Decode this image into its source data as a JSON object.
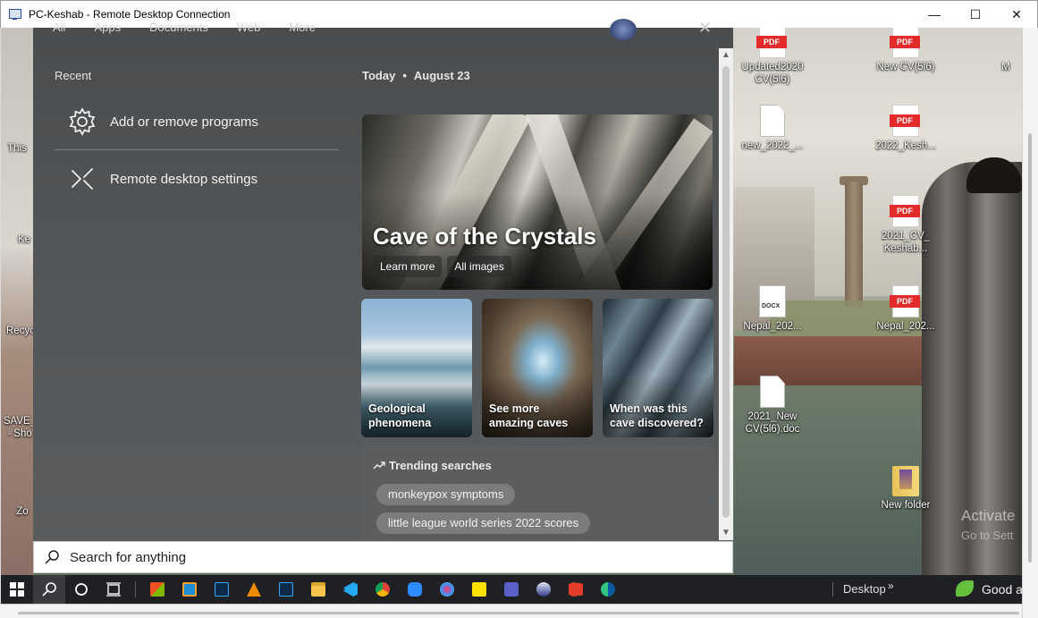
{
  "window": {
    "title": "PC-Keshab - Remote Desktop Connection",
    "minimize": "—",
    "maximize": "☐",
    "close": "✕"
  },
  "panel": {
    "top_tabs": [
      "All",
      "Apps",
      "Documents",
      "Web",
      "More"
    ],
    "recent": {
      "label": "Recent",
      "items": [
        {
          "label": "Add or remove programs",
          "icon": "gear-icon"
        },
        {
          "label": "Remote desktop settings",
          "icon": "remote-desktop-icon"
        }
      ]
    },
    "today": {
      "label": "Today",
      "separator": "•",
      "date": "August 23"
    },
    "hero": {
      "title": "Cave of the Crystals",
      "buttons": [
        "Learn more",
        "All images"
      ]
    },
    "tiles": [
      {
        "label": "Geological phenomena"
      },
      {
        "label": "See more amazing caves"
      },
      {
        "label": "When was this cave discovered?"
      }
    ],
    "trending": {
      "label": "Trending searches",
      "chips": [
        "monkeypox symptoms",
        "little league world series 2022 scores"
      ]
    }
  },
  "search": {
    "placeholder": "Search for anything"
  },
  "desktop": {
    "icons": [
      {
        "label": "Updated2020 CV(5l6)",
        "type": "pdf"
      },
      {
        "label": "New CV(5l6)",
        "type": "pdf"
      },
      {
        "label": "M",
        "type": "pdf"
      },
      {
        "label": "new_2022_...",
        "type": "blank"
      },
      {
        "label": "2022_Kesh...",
        "type": "pdf"
      },
      {
        "label": "2021_CV_ Keshab...",
        "type": "pdf"
      },
      {
        "label": "Nepal_202...",
        "type": "docx"
      },
      {
        "label": "Nepal_202...",
        "type": "pdf"
      },
      {
        "label": "2021_New CV(5l6).doc",
        "type": "blank"
      },
      {
        "label": "New folder",
        "type": "folder"
      }
    ],
    "left_fragments": [
      "This",
      "Ke",
      "Recyc",
      "SAVE_",
      "- Sho",
      "Zo"
    ],
    "activate_line1": "Activate",
    "activate_line2": "Go to Sett"
  },
  "taskbar": {
    "desktop_label": "Desktop",
    "chevron": "»",
    "weather_text": "Good a",
    "pdf_tag": "PDF",
    "docx_tag": "DOCX"
  },
  "colors": {
    "panel_bg": "#505254",
    "taskbar_bg": "#1f2023",
    "pdf_red": "#e42b2b"
  }
}
